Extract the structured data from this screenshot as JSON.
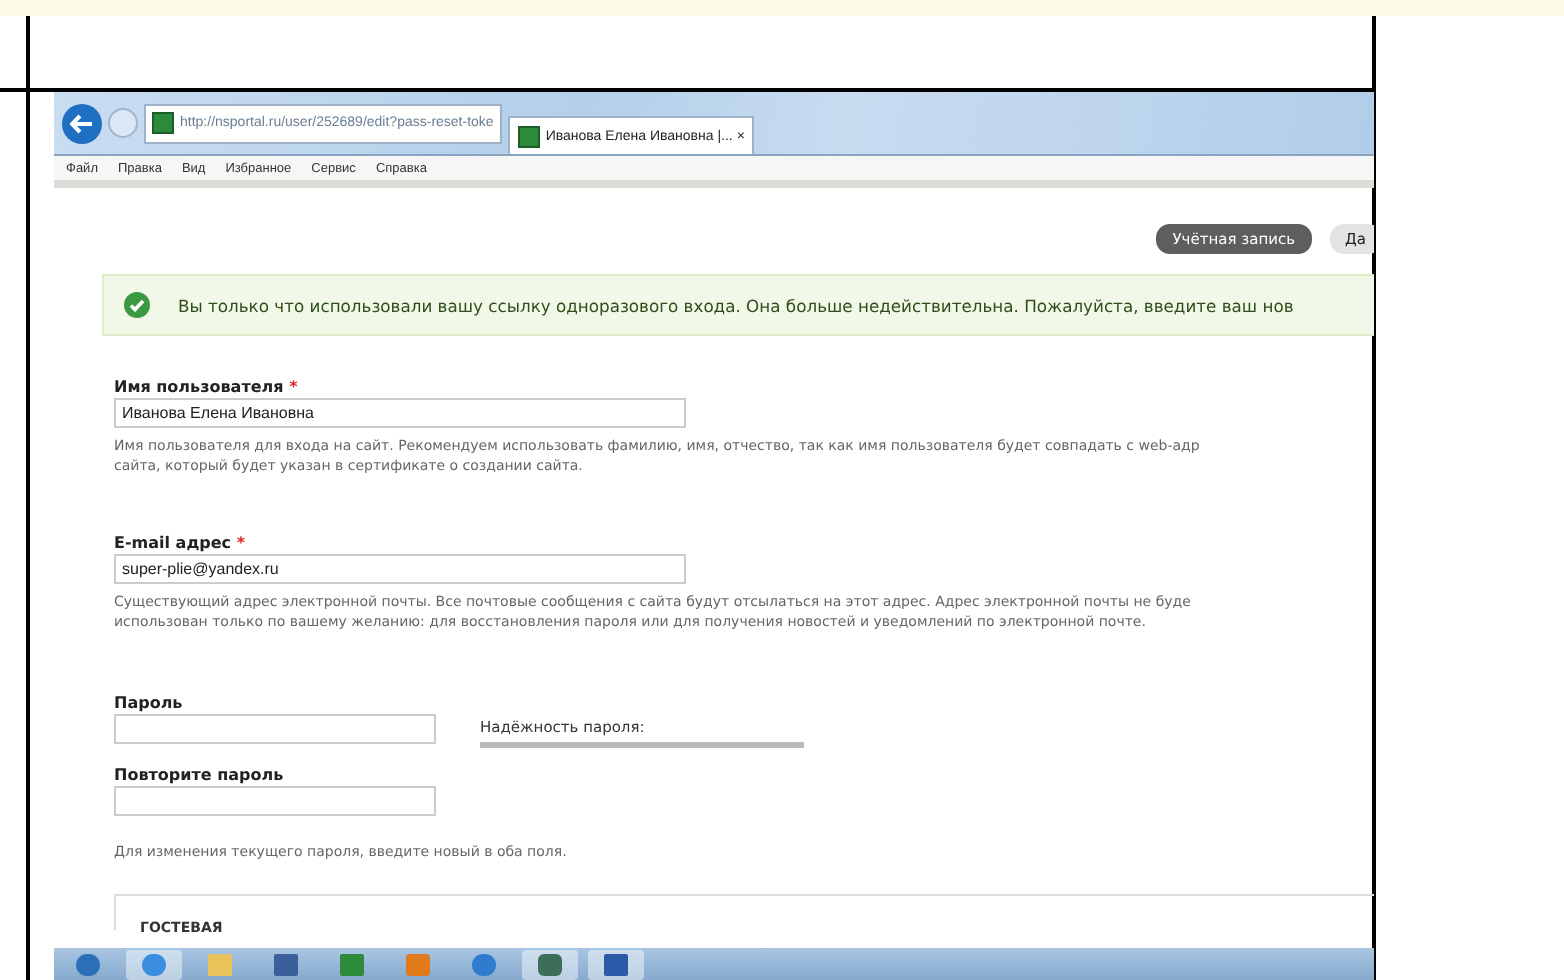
{
  "browser": {
    "address": "http://nsportal.ru/user/252689/edit?pass-reset-toke",
    "tab_title": "Иванова Елена Ивановна |... ×",
    "menu": [
      "Файл",
      "Правка",
      "Вид",
      "Избранное",
      "Сервис",
      "Справка"
    ]
  },
  "page": {
    "tabs": [
      {
        "label": "Учётная запись",
        "selected": true
      },
      {
        "label": "Да",
        "selected": false
      }
    ],
    "message": "Вы только что использовали вашу ссылку одноразового входа. Она больше недействительна. Пожалуйста, введите ваш нов",
    "fields": [
      {
        "label": "Имя пользователя",
        "required_mark": "*",
        "value": "Иванова Елена Ивановна",
        "help": [
          "Имя пользователя для входа на сайт. Рекомендуем использовать фамилию, имя, отчество, так как имя пользователя будет совпадать с web-адр",
          "сайта, который будет указан в сертификате о создании сайта."
        ]
      },
      {
        "label": "E-mail адрес",
        "required_mark": "*",
        "value": "super-plie@yandex.ru",
        "help": [
          "Существующий адрес электронной почты. Все почтовые сообщения с сайта будут отсылаться на этот адрес. Адрес электронной почты не буде",
          "использован только по вашему желанию: для восстановления пароля или для получения новостей и уведомлений по электронной почте."
        ]
      }
    ],
    "password": {
      "label": "Пароль",
      "strength_label": "Надёжность пароля:",
      "confirm_label": "Повторите пароль",
      "help": "Для изменения текущего пароля, введите новый в оба поля."
    },
    "section_title": "ГОСТЕВАЯ"
  }
}
